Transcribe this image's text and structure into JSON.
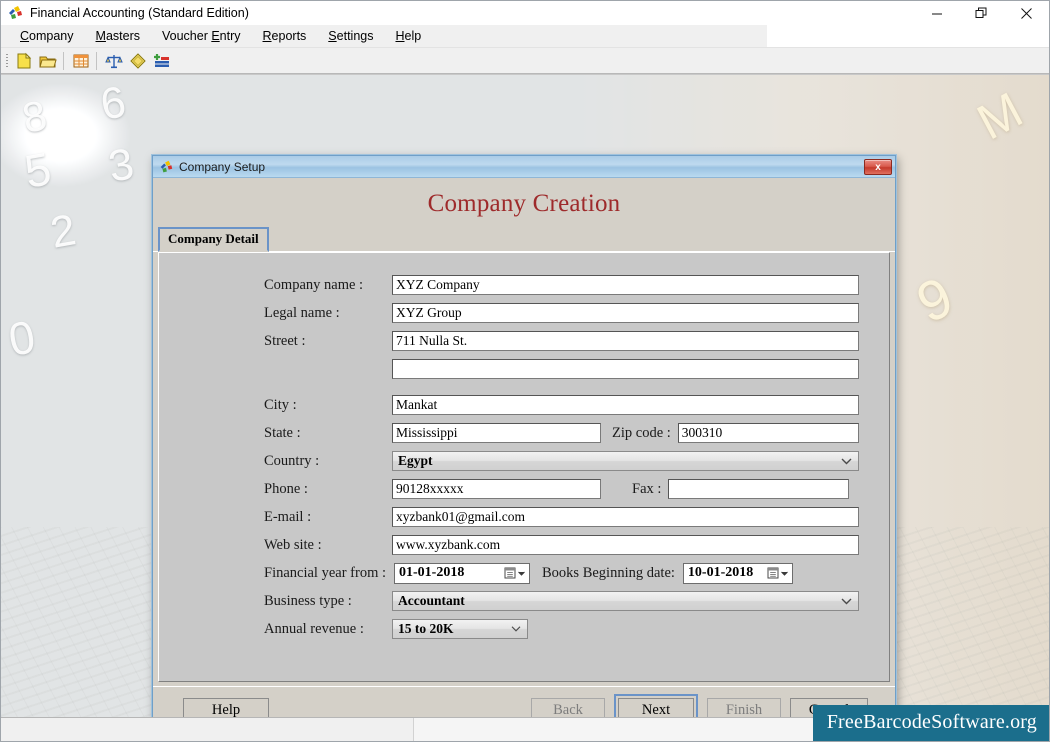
{
  "app": {
    "title": "Financial Accounting (Standard Edition)",
    "icon": "app-puzzle-icon",
    "window_controls": [
      {
        "name": "minimize",
        "glyph": "minimize-icon"
      },
      {
        "name": "maximize",
        "glyph": "restore-icon"
      },
      {
        "name": "close",
        "glyph": "close-icon"
      }
    ]
  },
  "menubar": {
    "items": [
      {
        "label": "Company",
        "pre": "",
        "accel": "C",
        "post": "ompany"
      },
      {
        "label": "Masters",
        "pre": "",
        "accel": "M",
        "post": "asters"
      },
      {
        "label": "Voucher Entry",
        "pre": "Voucher ",
        "accel": "E",
        "post": "ntry"
      },
      {
        "label": "Reports",
        "pre": "",
        "accel": "R",
        "post": "eports"
      },
      {
        "label": "Settings",
        "pre": "",
        "accel": "S",
        "post": "ettings"
      },
      {
        "label": "Help",
        "pre": "",
        "accel": "H",
        "post": "elp"
      }
    ]
  },
  "toolbar": {
    "buttons": [
      {
        "name": "new-company-icon",
        "title": "New"
      },
      {
        "name": "open-company-icon",
        "title": "Open"
      },
      {
        "name": "ledger-table-icon",
        "title": "Ledgers"
      },
      {
        "name": "trial-balance-icon",
        "title": "Trial Balance"
      },
      {
        "name": "voucher-icon",
        "title": "Voucher"
      },
      {
        "name": "reports-chart-icon",
        "title": "Reports"
      }
    ]
  },
  "dialog": {
    "title": "Company Setup",
    "icon": "app-puzzle-icon",
    "close_glyph": "x",
    "heading": "Company Creation",
    "tab": {
      "label": "Company Detail",
      "selected": true
    },
    "fields": {
      "company_name": {
        "label": "Company name :",
        "value": "XYZ Company"
      },
      "legal_name": {
        "label": "Legal name :",
        "value": "XYZ Group"
      },
      "street": {
        "label": "Street :",
        "value": "711 Nulla St."
      },
      "street2": {
        "label": "",
        "value": ""
      },
      "city": {
        "label": "City :",
        "value": "Mankat"
      },
      "state": {
        "label": "State :",
        "value": "Mississippi"
      },
      "zip": {
        "label": "Zip code :",
        "value": "300310"
      },
      "country": {
        "label": "Country :",
        "value": "Egypt"
      },
      "phone": {
        "label": "Phone :",
        "value": "90128xxxxx"
      },
      "fax": {
        "label": "Fax :",
        "value": ""
      },
      "email": {
        "label": "E-mail :",
        "value": "xyzbank01@gmail.com"
      },
      "website": {
        "label": "Web site :",
        "value": "www.xyzbank.com"
      },
      "fy_from": {
        "label": "Financial year from :",
        "value": "01-01-2018"
      },
      "books_begin": {
        "label": "Books Beginning date:",
        "value": "10-01-2018"
      },
      "business_type": {
        "label": "Business type :",
        "value": "Accountant"
      },
      "annual_revenue": {
        "label": "Annual revenue :",
        "value": "15 to 20K"
      }
    },
    "buttons": {
      "help": {
        "label": "Help",
        "enabled": true,
        "focused": false
      },
      "back": {
        "label": "Back",
        "enabled": false,
        "focused": false
      },
      "next": {
        "label": "Next",
        "enabled": true,
        "focused": true
      },
      "finish": {
        "label": "Finish",
        "enabled": false,
        "focused": false
      },
      "cancel": {
        "label": "Cancel",
        "enabled": true,
        "focused": false
      }
    }
  },
  "background": {
    "left_numerals": [
      "8",
      "6",
      "5",
      "3",
      "2",
      "0"
    ],
    "right_numerals": [
      "M",
      "9"
    ]
  },
  "watermark": {
    "text": "FreeBarcodeSoftware.org",
    "color": "#1b6e8c"
  },
  "statusbar": {
    "panel1": "",
    "panel2": ""
  }
}
